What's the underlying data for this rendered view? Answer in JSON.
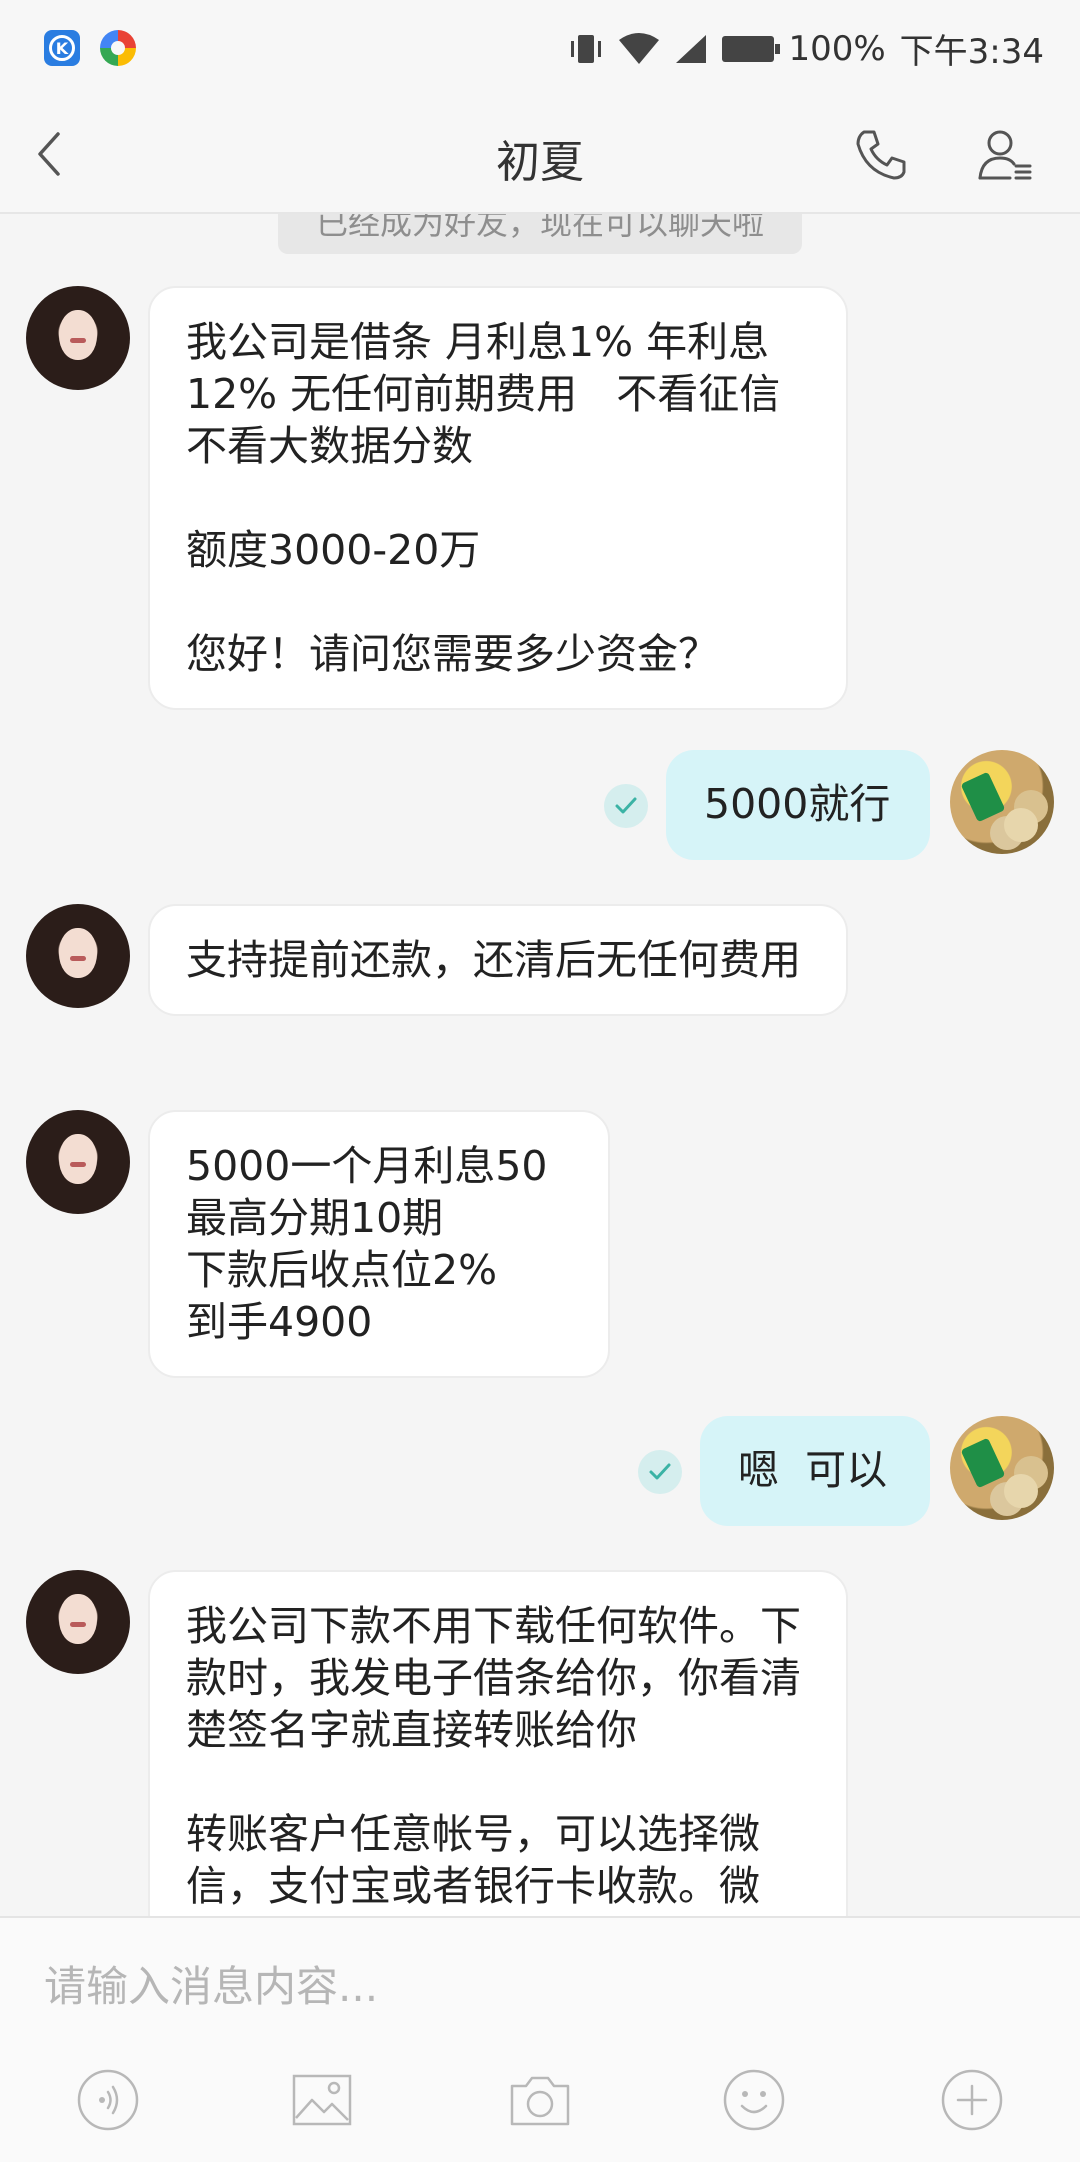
{
  "status_bar": {
    "battery_percent": "100%",
    "time": "下午3:34",
    "app_icons": [
      "k-app-icon",
      "pinwheel-app-icon"
    ]
  },
  "header": {
    "title": "初夏",
    "icons": [
      "back-icon",
      "phone-icon",
      "profile-icon"
    ]
  },
  "chat": {
    "system_tip": "已经成为好友，现在可以聊天啦",
    "messages": [
      {
        "from": "them",
        "text": "我公司是借条 月利息1% 年利息12% 无任何前期费用   不看征信 不看大数据分数\n\n额度3000-20万\n\n您好！请问您需要多少资金？"
      },
      {
        "from": "me",
        "text": "5000就行"
      },
      {
        "from": "them",
        "text": "支持提前还款，还清后无任何费用"
      },
      {
        "from": "them",
        "text": "5000一个月利息50\n最高分期10期\n下款后收点位2%\n到手4900"
      },
      {
        "from": "me",
        "text": "嗯  可以"
      },
      {
        "from": "them",
        "text": "我公司下款不用下载任何软件。下款时，我发电子借条给你，你看清楚签名字就直接转账给你\n\n转账客户任意帐号，可以选择微信，支付宝或者银行卡收款。微"
      }
    ]
  },
  "input": {
    "placeholder": "请输入消息内容..."
  },
  "toolbar": {
    "icons": [
      "voice-icon",
      "image-icon",
      "camera-icon",
      "emoji-icon",
      "plus-icon"
    ]
  },
  "colors": {
    "outgoing_bubble": "#d6f4f8",
    "incoming_bubble": "#ffffff",
    "read_check": "#3bb3a5"
  }
}
